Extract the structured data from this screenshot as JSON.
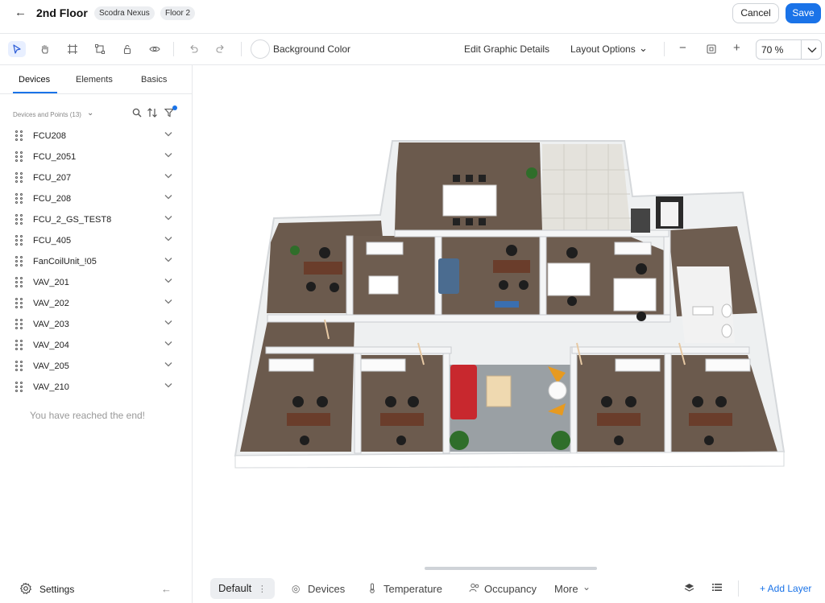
{
  "header": {
    "title": "2nd Floor",
    "chips": [
      "Scodra Nexus",
      "Floor 2"
    ],
    "cancel_label": "Cancel",
    "save_label": "Save",
    "accent": "#1a73e8"
  },
  "toolbar": {
    "background_color_label": "Background Color",
    "edit_graphic_label": "Edit Graphic Details",
    "layout_options_label": "Layout Options",
    "zoom": "70 %",
    "icons": [
      "pointer-icon",
      "hand-icon",
      "frame-icon",
      "crop-icon",
      "lock-icon",
      "eye-icon",
      "undo-icon",
      "redo-icon",
      "zoom-out-icon",
      "fit-icon",
      "zoom-in-icon"
    ]
  },
  "sidebar": {
    "tabs": [
      "Devices",
      "Elements",
      "Basics"
    ],
    "active_tab": "Devices",
    "devices_points_label": "Devices and Points (13)",
    "devices": [
      "FCU208",
      "FCU_2051",
      "FCU_207",
      "FCU_208",
      "FCU_2_GS_TEST8",
      "FCU_405",
      "FanCoilUnit_!05",
      "VAV_201",
      "VAV_202",
      "VAV_203",
      "VAV_204",
      "VAV_205",
      "VAV_210"
    ],
    "end_text": "You have reached the end!",
    "settings_label": "Settings"
  },
  "bottombar": {
    "layer": "Default",
    "items": [
      "Devices",
      "Temperature",
      "Occupancy",
      "More"
    ],
    "add_layer": "+ Add Layer"
  }
}
